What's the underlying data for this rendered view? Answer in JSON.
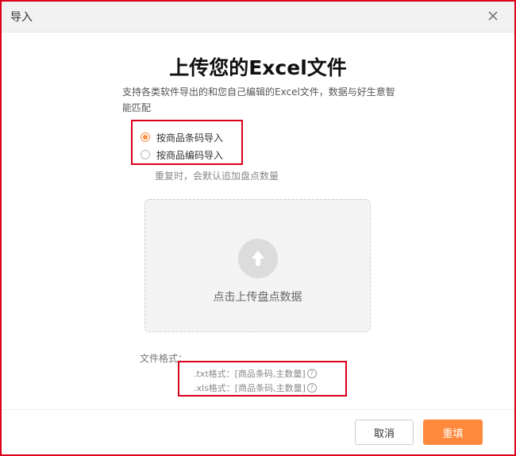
{
  "dialog": {
    "title": "导入",
    "close_icon": "close-icon"
  },
  "main": {
    "heading": "上传您的Excel文件",
    "description": "支持各类软件导出的和您自己编辑的Excel文件，数据与好生意智能匹配",
    "radio_options": [
      {
        "label": "按商品条码导入",
        "checked": true
      },
      {
        "label": "按商品编码导入",
        "checked": false
      }
    ],
    "hint": "重复时，会默认追加盘点数量",
    "upload": {
      "icon": "upload-arrow-icon",
      "text": "点击上传盘点数据"
    },
    "formats": {
      "label": "文件格式：",
      "txt": ".txt格式：[商品条码,主数量]",
      "xls": ".xls格式：[商品条码,主数量]",
      "help_glyph": "?"
    }
  },
  "footer": {
    "cancel_label": "取消",
    "confirm_label": "重填"
  },
  "colors": {
    "accent": "#ff8a3d",
    "highlight_border": "#d9001b"
  }
}
